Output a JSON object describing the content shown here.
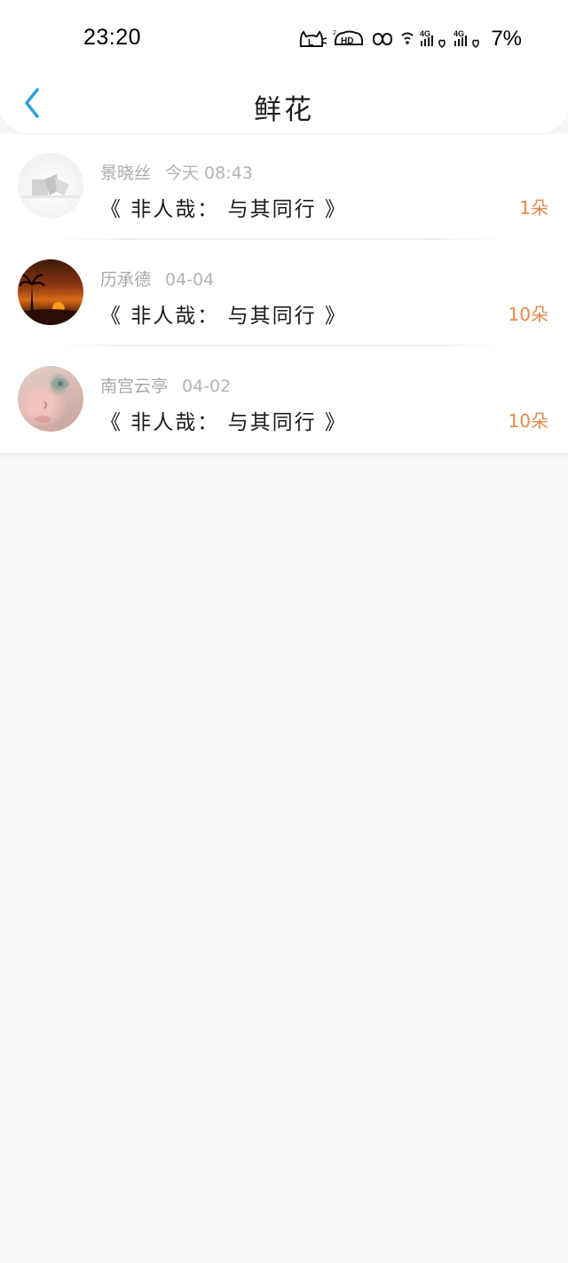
{
  "status_bar": {
    "time": "23:20",
    "battery": "7%",
    "icons": [
      "cat-app-icon",
      "hd-icon",
      "infinity-icon",
      "wifi-icon",
      "signal-4g-icon",
      "signal-4g-icon",
      "battery-icon"
    ]
  },
  "nav": {
    "title": "鲜花",
    "back_icon": "chevron-left-icon",
    "accent": "#2f9fe0"
  },
  "records": [
    {
      "name": "景晓丝",
      "date": "今天 08:43",
      "book": "《 非人哉： 与其同行 》",
      "count": "1朵"
    },
    {
      "name": "历承德",
      "date": "04-04",
      "book": "《 非人哉： 与其同行 》",
      "count": "10朵"
    },
    {
      "name": "南宫云亭",
      "date": "04-02",
      "book": "《 非人哉： 与其同行 》",
      "count": "10朵"
    }
  ],
  "colors": {
    "count": "#e5884a",
    "meta": "#a9a9a9",
    "page_bg": "#f8f6f7"
  }
}
